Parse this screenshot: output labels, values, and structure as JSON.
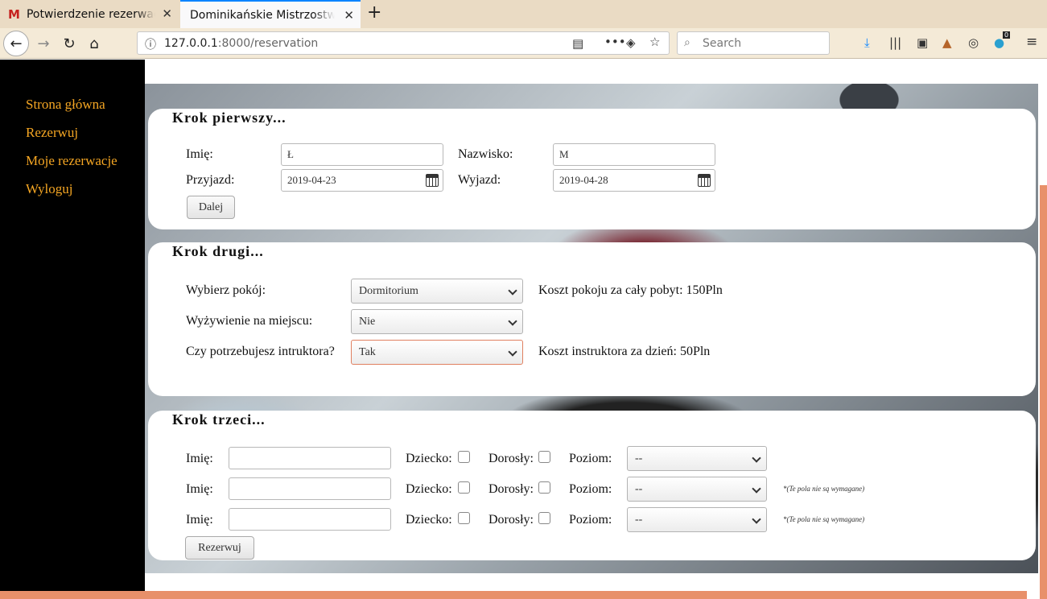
{
  "browser": {
    "tabs": [
      {
        "icon": "gmail-icon",
        "label": "Potwierdzenie rezerwac"
      },
      {
        "label": "Dominikańskie Mistrzostwa"
      }
    ],
    "url_host": "127.0.0.1",
    "url_path": ":8000/reservation",
    "search_placeholder": "Search",
    "badge_count": "0"
  },
  "nav": [
    "Strona główna",
    "Rezerwuj",
    "Moje rezerwacje",
    "Wyloguj"
  ],
  "step1": {
    "title": "Krok pierwszy...",
    "first_name_label": "Imię:",
    "first_name_value": "Ł",
    "last_name_label": "Nazwisko:",
    "last_name_value": "M",
    "arrival_label": "Przyjazd:",
    "arrival_value": "2019-04-23",
    "departure_label": "Wyjazd:",
    "departure_value": "2019-04-28",
    "next_button": "Dalej"
  },
  "step2": {
    "title": "Krok drugi...",
    "room_label": "Wybierz pokój:",
    "room_value": "Dormitorium",
    "room_cost": "Koszt pokoju za cały pobyt: 150Pln",
    "meals_label": "Wyżywienie na miejscu:",
    "meals_value": "Nie",
    "instructor_label": "Czy potrzebujesz intruktora?",
    "instructor_value": "Tak",
    "instructor_cost": "Koszt instruktora za dzień: 50Pln"
  },
  "step3": {
    "title": "Krok trzeci...",
    "name_label": "Imię:",
    "child_label": "Dziecko:",
    "adult_label": "Dorosły:",
    "level_label": "Poziom:",
    "level_value": "--",
    "optional_note": "*(Te pola nie są wymagane)",
    "reserve_button": "Rezerwuj"
  },
  "colors": {
    "accent": "#f5a623",
    "sidebar": "#000000",
    "bar": "#e8906a"
  }
}
